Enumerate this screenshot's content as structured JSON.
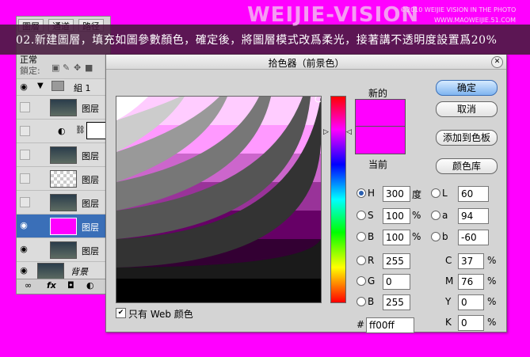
{
  "banner": {
    "logo": "WEIJIE-VISION",
    "logo_copyright": "©2010 WEIJIE VISION IN THE PHOTO",
    "logo_url": "WWW.MAOWEIJIE.51.COM",
    "caption": "02.新建圖層，填充如圖參數顏色，確定後，將圖層模式改爲柔光，接著講不透明度設置爲20%"
  },
  "layers_panel": {
    "tabs": [
      "圖層",
      "通道",
      "路径"
    ],
    "blend_mode_partial": "正常",
    "lock_label": "鎖定:",
    "group_name": "組 1",
    "layers": [
      {
        "name": "图层",
        "thumb": "photo",
        "visible": false
      },
      {
        "name": "",
        "thumb": "adjustment",
        "visible": false
      },
      {
        "name": "图层",
        "thumb": "photo",
        "visible": false
      },
      {
        "name": "图层",
        "thumb": "transparent",
        "visible": false
      },
      {
        "name": "图层",
        "thumb": "photo",
        "visible": false
      },
      {
        "name": "图层",
        "thumb": "magenta",
        "visible": true,
        "selected": true
      },
      {
        "name": "图层",
        "thumb": "photo",
        "visible": true
      }
    ],
    "background_name": "背景",
    "footer_icons": [
      "link-icon",
      "fx-icon",
      "mask-icon",
      "adjustment-icon"
    ]
  },
  "dialog": {
    "title": "拾色器（前景色）",
    "new_label": "新的",
    "current_label": "当前",
    "buttons": {
      "ok": "确定",
      "cancel": "取消",
      "add_swatch": "添加到色板",
      "library": "颜色库"
    },
    "hsb": [
      {
        "key": "H",
        "value": "300",
        "unit": "度",
        "selected": true
      },
      {
        "key": "S",
        "value": "100",
        "unit": "%",
        "selected": false
      },
      {
        "key": "B",
        "value": "100",
        "unit": "%",
        "selected": false
      }
    ],
    "rgb": [
      {
        "key": "R",
        "value": "255"
      },
      {
        "key": "G",
        "value": "0"
      },
      {
        "key": "B",
        "value": "255"
      }
    ],
    "lab": [
      {
        "key": "L",
        "value": "60"
      },
      {
        "key": "a",
        "value": "94"
      },
      {
        "key": "b",
        "value": "-60"
      }
    ],
    "cmyk": [
      {
        "key": "C",
        "value": "37",
        "unit": "%"
      },
      {
        "key": "M",
        "value": "76",
        "unit": "%"
      },
      {
        "key": "Y",
        "value": "0",
        "unit": "%"
      },
      {
        "key": "K",
        "value": "0",
        "unit": "%"
      }
    ],
    "hex_prefix": "#",
    "hex_value": "ff00ff",
    "web_only_label": "只有 Web 颜色",
    "web_only_checked": true,
    "selected_color": "#ff00ff"
  }
}
